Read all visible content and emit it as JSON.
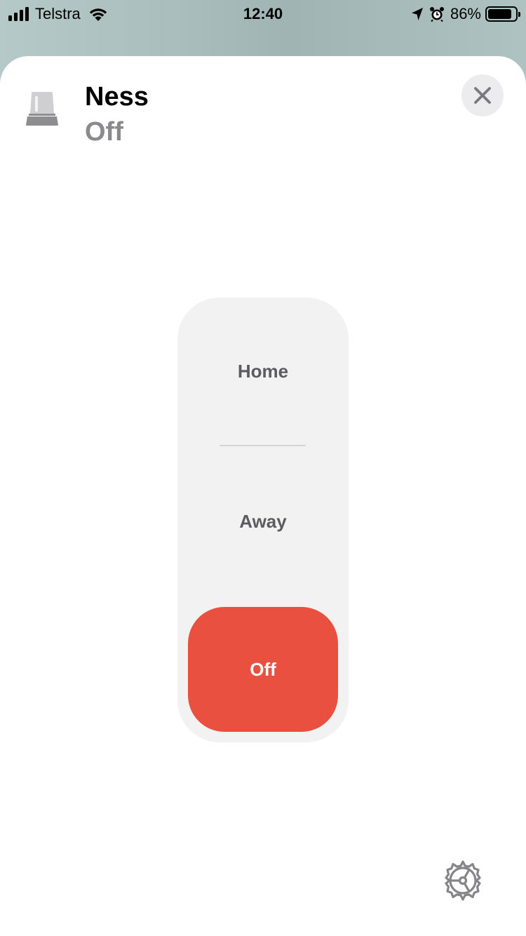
{
  "status_bar": {
    "carrier": "Telstra",
    "time": "12:40",
    "battery_percent": "86%",
    "battery_level": 0.86,
    "icons": [
      "signal-icon",
      "wifi-icon",
      "location-arrow-icon",
      "alarm-icon",
      "battery-icon"
    ]
  },
  "accessory": {
    "name": "Ness",
    "status": "Off",
    "icon": "security-system-icon"
  },
  "modes": {
    "home_label": "Home",
    "away_label": "Away",
    "off_label": "Off",
    "selected": "Off",
    "selected_color": "#ea5040"
  },
  "controls": {
    "close_icon": "close-icon",
    "settings_icon": "gear-icon"
  }
}
